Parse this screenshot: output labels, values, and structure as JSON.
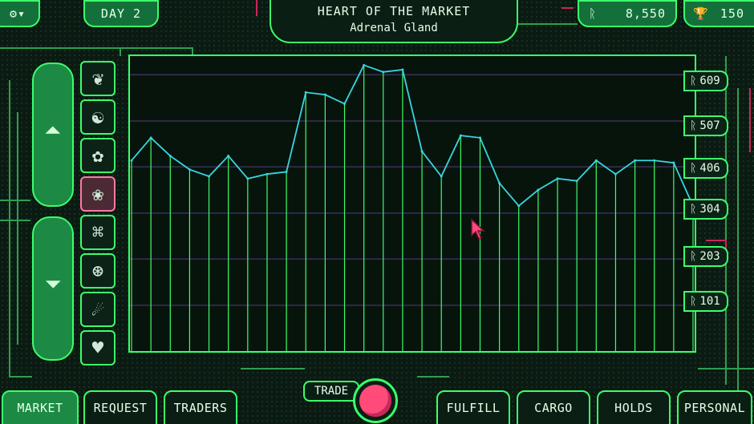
{
  "header": {
    "day_label": "DAY 2",
    "title": "HEART OF THE MARKET",
    "subtitle": "Adrenal Gland",
    "money_symbol": "ᚱ",
    "money_value": "8,550",
    "rep_icon": "trophy-icon",
    "rep_value": "150"
  },
  "y_ticks": [
    {
      "symbol": "ᚱ",
      "value": "609"
    },
    {
      "symbol": "ᚱ",
      "value": "507"
    },
    {
      "symbol": "ᚱ",
      "value": "406"
    },
    {
      "symbol": "ᚱ",
      "value": "304"
    },
    {
      "symbol": "ᚱ",
      "value": "203"
    },
    {
      "symbol": "ᚱ",
      "value": "101"
    }
  ],
  "chart_data": {
    "type": "line",
    "ylim": [
      0,
      650
    ],
    "grid": true,
    "values": [
      420,
      470,
      430,
      400,
      385,
      430,
      380,
      390,
      395,
      570,
      565,
      545,
      630,
      615,
      620,
      440,
      385,
      475,
      470,
      370,
      320,
      355,
      380,
      375,
      420,
      390,
      420,
      420,
      415,
      320
    ]
  },
  "items": [
    {
      "icon": "organ-icon-1",
      "selected": false
    },
    {
      "icon": "organ-icon-2",
      "selected": false
    },
    {
      "icon": "brain-icon",
      "selected": false
    },
    {
      "icon": "adrenal-gland-icon",
      "selected": true
    },
    {
      "icon": "organ-icon-5",
      "selected": false
    },
    {
      "icon": "eye-icon",
      "selected": false
    },
    {
      "icon": "organ-icon-7",
      "selected": false
    },
    {
      "icon": "heart-icon",
      "selected": false
    }
  ],
  "trade_label": "TRADE",
  "tabs": {
    "market": "MARKET",
    "request": "REQUEST",
    "traders": "TRADERS",
    "fulfill": "FULFILL",
    "cargo": "CARGO",
    "holds": "HOLDS",
    "personal": "PERSONAL"
  },
  "colors": {
    "accent": "#3cff6a",
    "line": "#38d6e0",
    "trade": "#ff4a7a"
  }
}
